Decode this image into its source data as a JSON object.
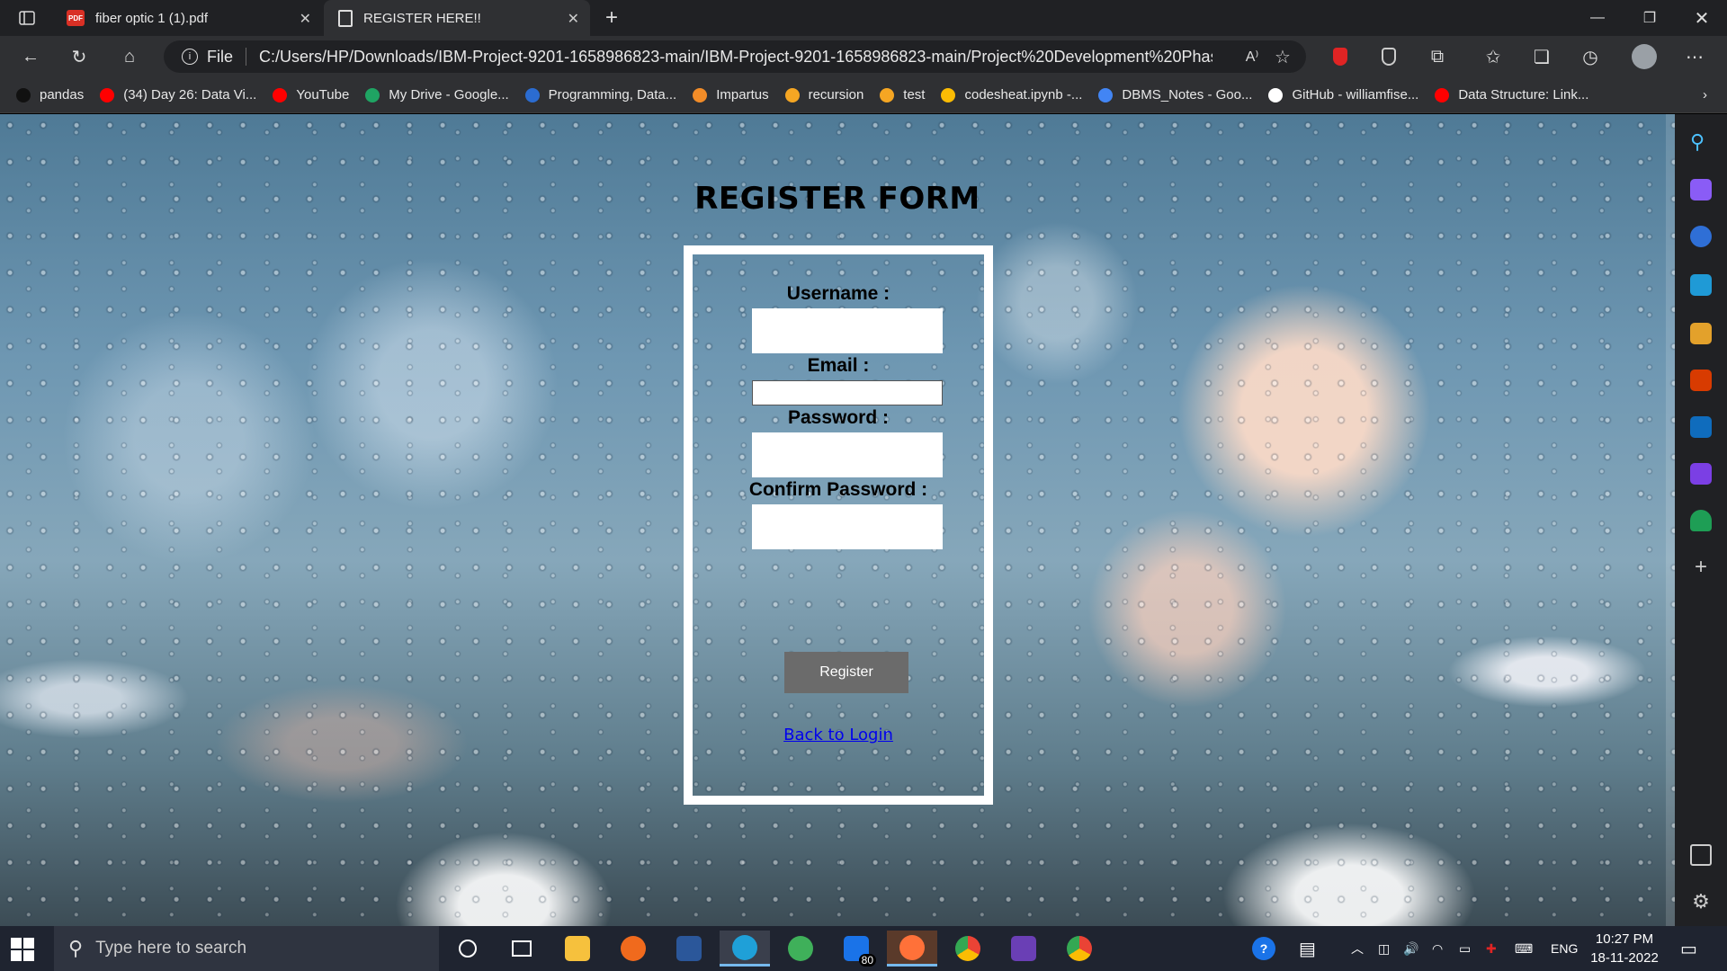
{
  "tabs": [
    {
      "title": "fiber optic 1 (1).pdf",
      "icon": "pdf-icon"
    },
    {
      "title": "REGISTER HERE!!",
      "icon": "document-icon"
    }
  ],
  "address": {
    "scheme": "File",
    "url": "C:/Users/HP/Downloads/IBM-Project-9201-1658986823-main/IBM-Project-9201-1658986823-main/Project%20Development%20Phase/..."
  },
  "bookmarks": [
    {
      "label": "pandas",
      "color": "#111111"
    },
    {
      "label": "(34) Day 26: Data Vi...",
      "color": "#ff0000"
    },
    {
      "label": "YouTube",
      "color": "#ff0000"
    },
    {
      "label": "My Drive - Google...",
      "color": "#1fa463"
    },
    {
      "label": "Programming, Data...",
      "color": "#2b6cd1"
    },
    {
      "label": "Impartus",
      "color": "#f28c28"
    },
    {
      "label": "recursion",
      "color": "#f5a623"
    },
    {
      "label": "test",
      "color": "#f5a623"
    },
    {
      "label": "codesheat.ipynb -...",
      "color": "#fbbc04"
    },
    {
      "label": "DBMS_Notes - Goo...",
      "color": "#4285f4"
    },
    {
      "label": "GitHub - williamfise...",
      "color": "#ffffff"
    },
    {
      "label": "Data Structure: Link...",
      "color": "#ff0000"
    }
  ],
  "form": {
    "title": "REGISTER FORM",
    "username_label": "Username :",
    "email_label": "Email :",
    "password_label": "Password :",
    "confirm_label": "Confirm Password :",
    "register_button": "Register",
    "back_link": "Back to Login"
  },
  "taskbar": {
    "search_placeholder": "Type here to search",
    "mail_badge": "80",
    "language": "ENG",
    "time": "10:27 PM",
    "date": "18-11-2022"
  }
}
